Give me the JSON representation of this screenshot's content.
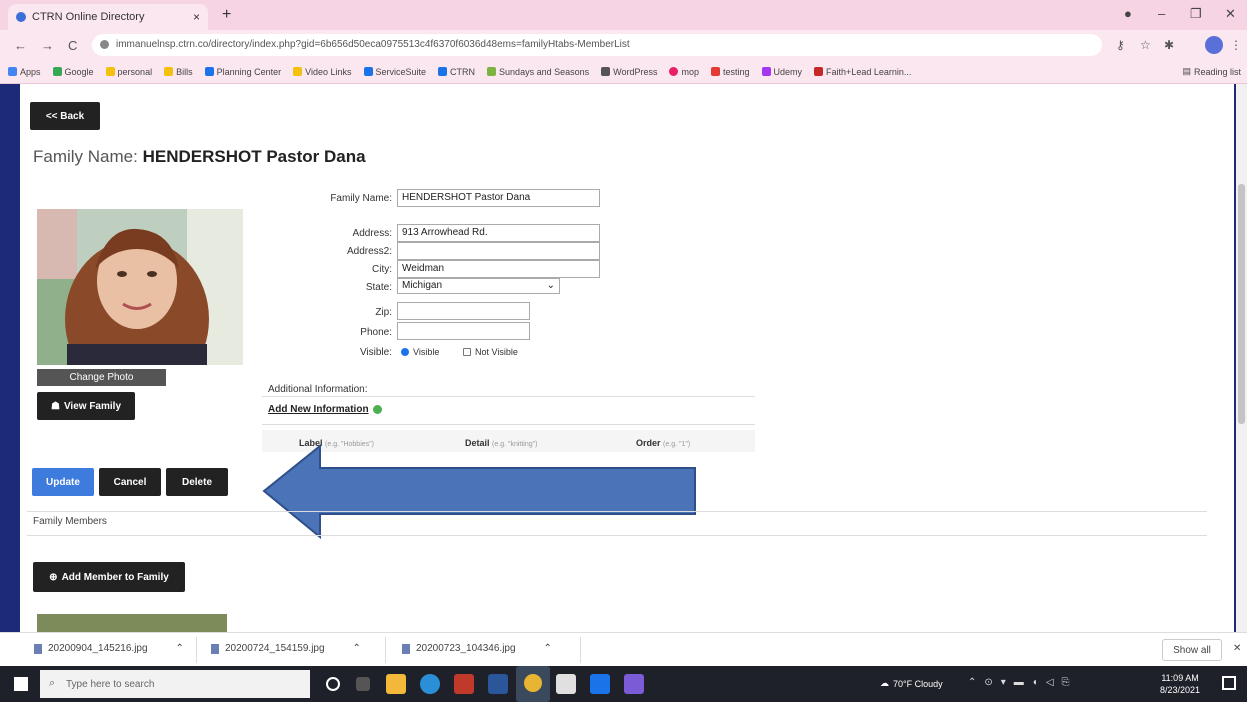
{
  "browser": {
    "tab_title": "CTRN Online Directory",
    "tab_close": "×",
    "new_tab": "+",
    "url": "immanuelnsp.ctrn.co/directory/index.php?gid=6b656d50eca0975513c4f6370f6036d48ems=familyHtabs-MemberList",
    "window_min": "–",
    "window_restore": "❐",
    "window_close": "✕",
    "bookmarks": [
      {
        "label": "Apps",
        "color": "#4285f4"
      },
      {
        "label": "Google",
        "color": "#34a853"
      },
      {
        "label": "personal",
        "color": "#f4c20d"
      },
      {
        "label": "Bills",
        "color": "#f4c20d"
      },
      {
        "label": "Planning Center",
        "color": "#1a73e8"
      },
      {
        "label": "Video Links",
        "color": "#f4c20d"
      },
      {
        "label": "ServiceSuite",
        "color": "#1a73e8"
      },
      {
        "label": "CTRN",
        "color": "#1a73e8"
      },
      {
        "label": "Sundays and Seasons",
        "color": "#7cb342"
      },
      {
        "label": "WordPress",
        "color": "#555"
      },
      {
        "label": "mop",
        "color": "#e91e63"
      },
      {
        "label": "testing",
        "color": "#e53935"
      },
      {
        "label": "Udemy",
        "color": "#a435f0"
      },
      {
        "label": "Faith+Lead Learnin...",
        "color": "#c62828"
      }
    ],
    "reading_list": "Reading list"
  },
  "page": {
    "back_label": "<< Back",
    "title_prefix": "Family Name:",
    "title_value": "HENDERSHOT Pastor Dana",
    "change_photo_label": "Change Photo",
    "view_family_label": "View Family",
    "form": {
      "family_name_label": "Family Name:",
      "family_name_value": "HENDERSHOT Pastor Dana",
      "address_label": "Address:",
      "address_value": "913 Arrowhead Rd.",
      "address2_label": "Address2:",
      "address2_value": "",
      "city_label": "City:",
      "city_value": "Weidman",
      "state_label": "State:",
      "state_value": "Michigan",
      "zip_label": "Zip:",
      "zip_value": "",
      "phone_label": "Phone:",
      "phone_value": "",
      "visible_label": "Visible:",
      "visible_option": "Visible",
      "not_visible_option": "Not Visible"
    },
    "additional_info_label": "Additional Information:",
    "add_new_info_label": "Add New Information",
    "columns": {
      "label": "Label",
      "label_hint": "(e.g. \"Hobbies\")",
      "detail": "Detail",
      "detail_hint": "(e.g. \"knitting\")",
      "order": "Order",
      "order_hint": "(e.g. \"1\")"
    },
    "update_label": "Update",
    "cancel_label": "Cancel",
    "delete_label": "Delete",
    "family_members_label": "Family Members",
    "add_member_label": "Add Member to Family",
    "arrow_color": "#4a73b8"
  },
  "downloads": {
    "items": [
      "20200904_145216.jpg",
      "20200724_154159.jpg",
      "20200723_104346.jpg"
    ],
    "show_all": "Show all"
  },
  "taskbar": {
    "search_placeholder": "Type here to search",
    "weather": "70°F Cloudy",
    "time": "11:09 AM",
    "date": "8/23/2021"
  }
}
